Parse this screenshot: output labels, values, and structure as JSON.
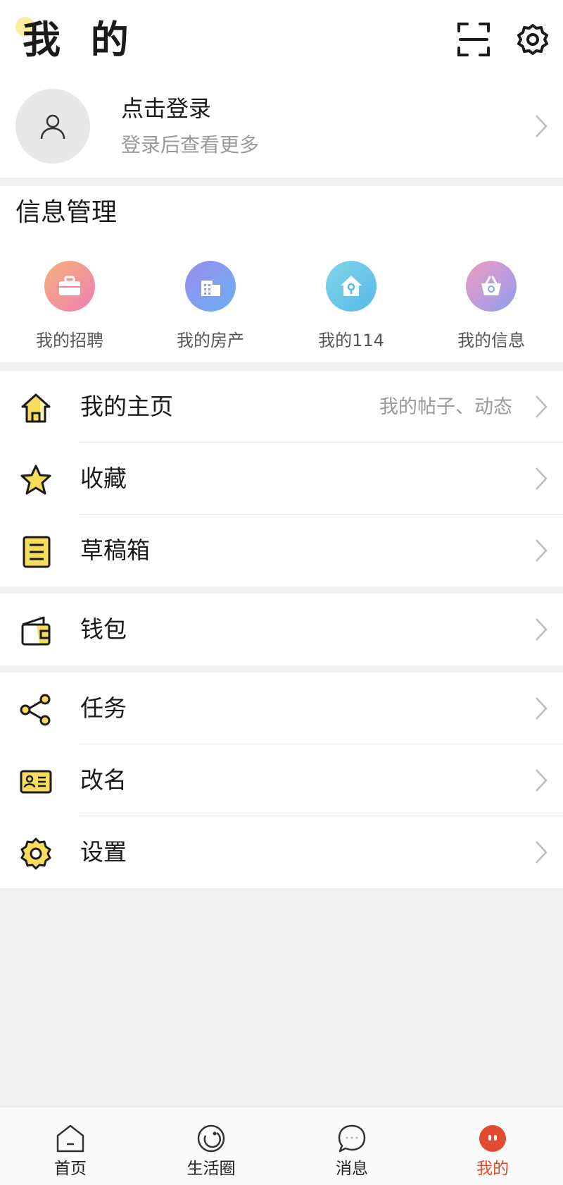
{
  "header": {
    "title": "我 的"
  },
  "profile": {
    "login_label": "点击登录",
    "login_sub": "登录后查看更多"
  },
  "info": {
    "title": "信息管理",
    "items": [
      {
        "label": "我的招聘",
        "icon": "briefcase-icon"
      },
      {
        "label": "我的房产",
        "icon": "building-icon"
      },
      {
        "label": "我的114",
        "icon": "house-key-icon"
      },
      {
        "label": "我的信息",
        "icon": "basket-icon"
      }
    ]
  },
  "menu": {
    "homepage": {
      "label": "我的主页",
      "hint": "我的帖子、动态"
    },
    "favorites": {
      "label": "收藏"
    },
    "drafts": {
      "label": "草稿箱"
    },
    "wallet": {
      "label": "钱包"
    },
    "tasks": {
      "label": "任务"
    },
    "rename": {
      "label": "改名"
    },
    "settings": {
      "label": "设置"
    }
  },
  "tabbar": [
    {
      "label": "首页"
    },
    {
      "label": "生活圈"
    },
    {
      "label": "消息"
    },
    {
      "label": "我的",
      "active": true
    }
  ],
  "colors": {
    "accent": "#e14b2f",
    "highlight": "#f8dc5c"
  }
}
